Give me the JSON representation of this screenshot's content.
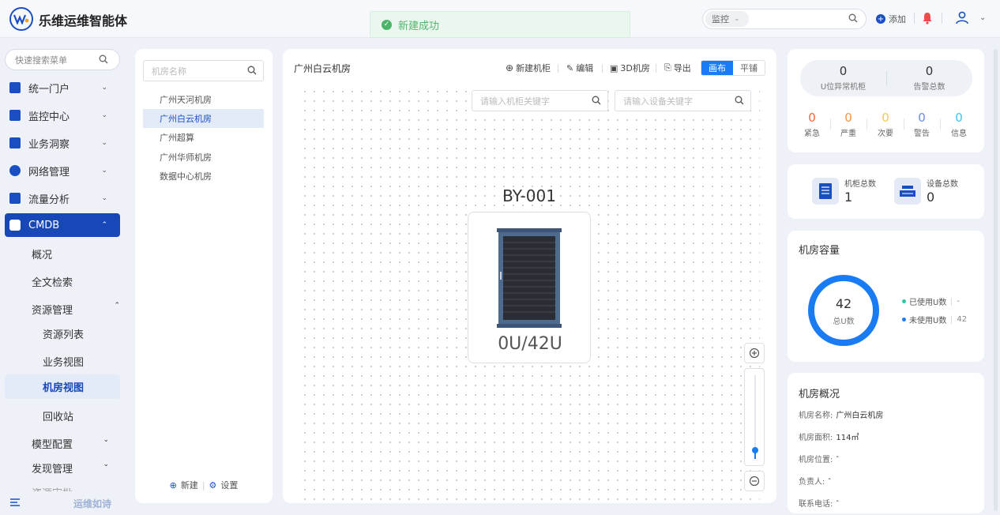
{
  "header": {
    "app_title": "乐维运维智能体",
    "toast": "新建成功",
    "search_type": "监控",
    "add_label": "添加"
  },
  "sidebar": {
    "search_placeholder": "快速搜索菜单",
    "items": [
      {
        "label": "统一门户"
      },
      {
        "label": "监控中心"
      },
      {
        "label": "业务洞察"
      },
      {
        "label": "网络管理"
      },
      {
        "label": "流量分析"
      },
      {
        "label": "CMDB"
      }
    ],
    "cmdb_children": [
      "概况",
      "全文检索",
      "资源管理"
    ],
    "resource_children": [
      "资源列表",
      "业务视图",
      "机房视图",
      "回收站"
    ],
    "more_items": [
      "模型配置",
      "发现管理"
    ],
    "truncated_item": "资源审批",
    "footer_slogan": "运维如诗"
  },
  "rooms": {
    "search_placeholder": "机房名称",
    "items": [
      "广州天河机房",
      "广州白云机房",
      "广州超算",
      "广州华师机房",
      "数据中心机房"
    ],
    "selected_index": 1,
    "new_label": "新建",
    "settings_label": "设置"
  },
  "canvas": {
    "title": "广州白云机房",
    "toolbar": {
      "new_cabinet": "新建机柜",
      "edit": "编辑",
      "room_3d": "3D机房",
      "export": "导出",
      "mode_canvas": "画布",
      "mode_flat": "平铺"
    },
    "cabinet_search_placeholder": "请输入机柜关键字",
    "device_search_placeholder": "请输入设备关键字",
    "rack": {
      "name": "BY-001",
      "usage": "0U/42U"
    },
    "zoom_level": 0.1
  },
  "stats": {
    "abnormal_cabinets": {
      "value": "0",
      "label": "U位异常机柜"
    },
    "total_alerts": {
      "value": "0",
      "label": "告警总数"
    },
    "levels": [
      {
        "value": "0",
        "label": "紧急",
        "color": "#f5643c"
      },
      {
        "value": "0",
        "label": "严重",
        "color": "#f79646"
      },
      {
        "value": "0",
        "label": "次要",
        "color": "#f7c948"
      },
      {
        "value": "0",
        "label": "警告",
        "color": "#6a8cf0"
      },
      {
        "value": "0",
        "label": "信息",
        "color": "#3fc3f0"
      }
    ]
  },
  "counts": {
    "cabinets": {
      "label": "机柜总数",
      "value": "1"
    },
    "devices": {
      "label": "设备总数",
      "value": "0"
    }
  },
  "capacity": {
    "title": "机房容量",
    "total": "42",
    "total_label": "总U数",
    "used_label": "已使用U数",
    "used_value": "-",
    "unused_label": "未使用U数",
    "unused_value": "42",
    "used_color": "#2ec7a0",
    "unused_color": "#1a7cf5"
  },
  "overview": {
    "title": "机房概况",
    "rows": [
      {
        "label": "机房名称:",
        "value": "广州白云机房"
      },
      {
        "label": "机房面积:",
        "value": "114㎡"
      },
      {
        "label": "机房位置:",
        "value": "-"
      },
      {
        "label": "负责人:",
        "value": "-"
      },
      {
        "label": "联系电话:",
        "value": "-"
      }
    ]
  }
}
